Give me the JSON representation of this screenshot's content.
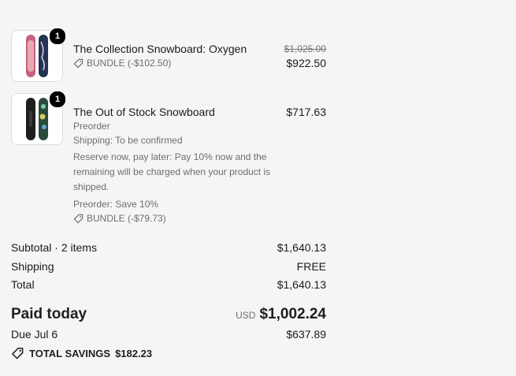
{
  "items": [
    {
      "title": "The Collection Snowboard: Oxygen",
      "quantity": "1",
      "original_price": "$1,025.00",
      "price": "$922.50",
      "discount": "BUNDLE (-$102.50)"
    },
    {
      "title": "The Out of Stock Snowboard",
      "quantity": "1",
      "price": "$717.63",
      "preorder": "Preorder",
      "shipping": "Shipping: To be confirmed",
      "note": "Reserve now, pay later: Pay 10% now and the remaining will be charged when your product is shipped.",
      "savings_note": "Preorder: Save 10%",
      "discount": "BUNDLE (-$79.73)"
    }
  ],
  "totals": {
    "subtotal_label": "Subtotal · 2 items",
    "subtotal_value": "$1,640.13",
    "shipping_label": "Shipping",
    "shipping_value": "FREE",
    "total_label": "Total",
    "total_value": "$1,640.13"
  },
  "payment": {
    "paid_label": "Paid today",
    "currency": "USD",
    "paid_value": "$1,002.24",
    "due_label": "Due Jul 6",
    "due_value": "$637.89"
  },
  "savings": {
    "label": "TOTAL SAVINGS",
    "value": "$182.23"
  },
  "colors": {
    "background": "#f7f4f5",
    "text": "#1b1b1b",
    "muted": "#6e6e6e",
    "badge": "#000000"
  },
  "icons": [
    "tag-icon",
    "snowboard-thumbnail"
  ]
}
